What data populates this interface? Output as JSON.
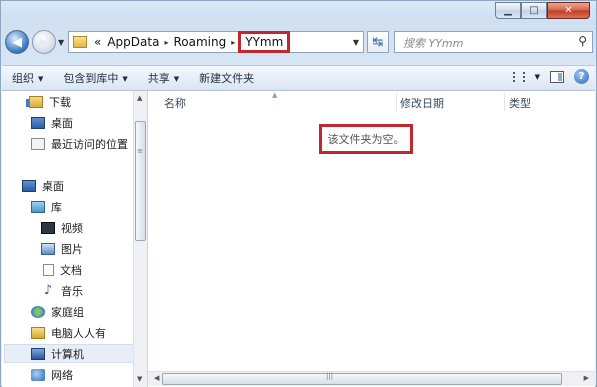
{
  "window": {
    "minimize_glyph": "▁",
    "maximize_glyph": "□",
    "close_glyph": "✕"
  },
  "nav": {
    "back_glyph": "◀",
    "forward_glyph": "▶",
    "history_drop": "▼",
    "breadcrumb": {
      "overflow": "«",
      "items": [
        "AppData",
        "Roaming"
      ],
      "current": "YYmm",
      "separator": "▸"
    },
    "address_drop": "▼",
    "refresh_glyph": "↹"
  },
  "search": {
    "placeholder": "搜索 YYmm",
    "icon_glyph": "⚲"
  },
  "toolbar": {
    "organize": "组织",
    "include_in_library": "包含到库中",
    "share": "共享",
    "new_folder": "新建文件夹",
    "dropdown_glyph": "▼",
    "help_glyph": "?"
  },
  "sidebar": {
    "favorites": [
      {
        "label": "下载",
        "icon": "download-folder-icon"
      },
      {
        "label": "桌面",
        "icon": "desktop-icon"
      },
      {
        "label": "最近访问的位置",
        "icon": "recent-places-icon"
      }
    ],
    "desktop": "桌面",
    "library": "库",
    "library_items": [
      {
        "label": "视频",
        "icon": "video-icon"
      },
      {
        "label": "图片",
        "icon": "picture-icon"
      },
      {
        "label": "文档",
        "icon": "document-icon"
      },
      {
        "label": "音乐",
        "icon": "music-icon"
      }
    ],
    "homegroup": "家庭组",
    "user": "电脑人人有",
    "computer": "计算机",
    "network": "网络",
    "selected": "计算机"
  },
  "content": {
    "columns": [
      "名称",
      "修改日期",
      "类型"
    ],
    "empty_message": "该文件夹为空。"
  },
  "colors": {
    "highlight_box": "#c1272d",
    "window_frame": "#cfe0f2"
  }
}
